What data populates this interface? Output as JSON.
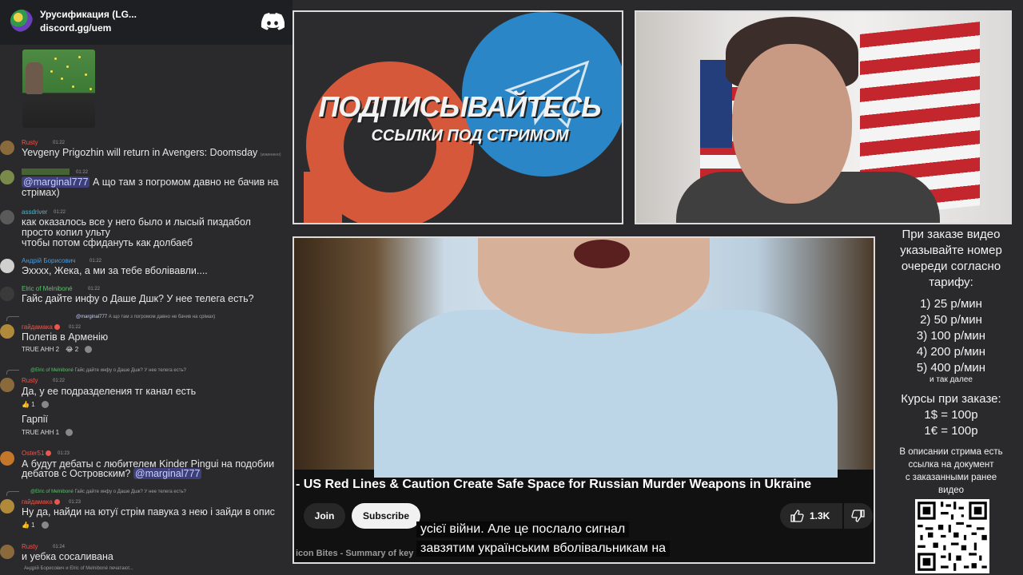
{
  "discord": {
    "server_name": "Урусификация (LG...",
    "server_invite": "discord.gg/uem",
    "typing_text": "Андрій Борисович и Elric of Melniboné печатают...",
    "messages": [
      {
        "user": "Rusty",
        "user_color": "#e8584f",
        "time": "01:22",
        "text": "Yevgeny Prigozhin will return in Avengers: Doomsday",
        "edited": "(изменено)"
      },
      {
        "user": "",
        "user_color": "#5a8a3a",
        "time": "01:22",
        "mention": "@marginal777",
        "text": "А що там з погромом давно не бачив на",
        "text2": "стрімах)"
      },
      {
        "user": "assdriver",
        "user_color": "#4fb3c9",
        "time": "01:22",
        "text": "как оказалось все у него было и лысый пиздабол",
        "text2": "просто копил ульту",
        "text3": "чтобы потом сфидануть как долбаеб"
      },
      {
        "user": "Андрій Борисович",
        "user_color": "#4f9bd9",
        "time": "01:22",
        "text": "Эхххх, Жека, а ми за тебе вболівавли...."
      },
      {
        "user": "Elric of Melniboné",
        "user_color": "#59c36a",
        "time": "01:22",
        "text": "Гайс дайте инфу о Даше Дшк? У нее телега есть?"
      },
      {
        "reply_user": "@marginal777",
        "reply_text": "А що там з погромом давно не бачив на срімах)",
        "user": "гайдамака",
        "user_color": "#e8584f",
        "time": "01:22",
        "text": "Полетів в Арменію",
        "reactions": [
          "TRUE AHH 2",
          "😂 2"
        ]
      },
      {
        "reply_user": "@Elric of Melniboné",
        "reply_text": "Гайс дайте инфу о Даше Дшк? У нее телега есть?",
        "user": "Rusty",
        "user_color": "#e8584f",
        "time": "01:22",
        "text": "Да, у ее подразделения тг канал есть",
        "reactions": [
          "👍 1"
        ],
        "text_after": "Гарпії",
        "reactions2": [
          "TRUE AHH 1"
        ]
      },
      {
        "user": "Oster51",
        "user_color": "#e8584f",
        "time": "01:23",
        "text": "А будут дебаты с любителем Kinder Pingui на подобии",
        "text2": "дебатов с Островским?",
        "mention2": "@marginal777"
      },
      {
        "reply_user": "@Elric of Melniboné",
        "reply_text": "Гайс дайте инфу о Даше Дшк? У нее телега есть?",
        "user": "гайдамака",
        "user_color": "#e8584f",
        "time": "01:23",
        "text": "Ну да, найди на ютуї стрім павука з нею і зайди в опис",
        "reactions": [
          "👍 1"
        ]
      },
      {
        "user": "Rusty",
        "user_color": "#e8584f",
        "time": "01:24",
        "text": "и уебка сосаливана"
      }
    ]
  },
  "promo": {
    "title": "ПОДПИСЫВАЙТЕСЬ",
    "subtitle": "ССЫЛКИ ПОД СТРИМОМ"
  },
  "video": {
    "title": "- US Red Lines & Caution Create Safe Space for Russian Murder Weapons in Ukraine",
    "join_label": "Join",
    "subscribe_label": "Subscribe",
    "like_count": "1.3K",
    "channel_line": "icon Bites - Summary of key",
    "caption_line1": "усієї війни.  Але це послало сигнал",
    "caption_line2": "завзятим українським вболівальникам на"
  },
  "info": {
    "lines": [
      "При заказе видео",
      "указывайте номер",
      "очереди согласно",
      "тарифу:",
      "1) 25 р/мин",
      "2) 50 р/мин",
      "3) 100 р/мин",
      "4) 200 р/мин",
      "5) 400 р/мин",
      "и так далее",
      "Курсы при заказе:",
      "1$ = 100р",
      "1€ = 100р",
      "В описании стрима есть",
      "ссылка на документ",
      "с заказанными ранее",
      "видео"
    ]
  },
  "colors": {
    "patreon": "#d5583a",
    "telegram": "#2a86c6",
    "discord_bg": "#2a2a2c"
  }
}
